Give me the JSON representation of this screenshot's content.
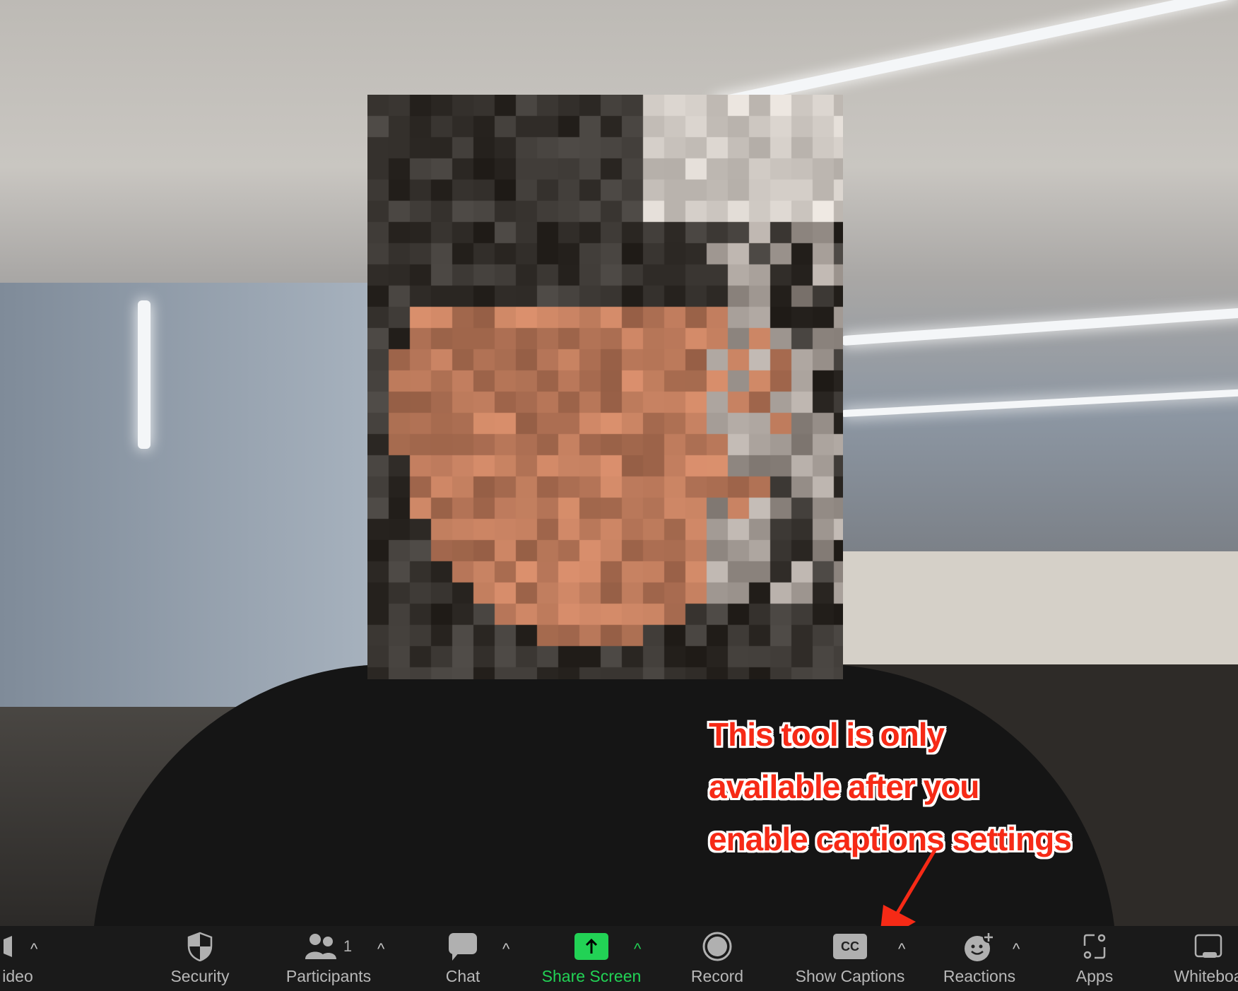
{
  "annotation": {
    "lines": [
      "This tool is only",
      "available after you",
      "enable captions settings"
    ],
    "color": "#f62a16"
  },
  "toolbar": {
    "items": [
      {
        "label": "ideo",
        "icon": "video-camera-icon"
      },
      {
        "label": "Security",
        "icon": "shield-icon"
      },
      {
        "label": "Participants",
        "icon": "participants-icon",
        "count": "1"
      },
      {
        "label": "Chat",
        "icon": "chat-bubble-icon"
      },
      {
        "label": "Share Screen",
        "icon": "share-screen-icon",
        "color": "#22d255"
      },
      {
        "label": "Record",
        "icon": "record-icon"
      },
      {
        "label": "Show Captions",
        "icon": "cc-icon",
        "icon_text": "CC"
      },
      {
        "label": "Reactions",
        "icon": "emoji-add-icon"
      },
      {
        "label": "Apps",
        "icon": "apps-icon"
      },
      {
        "label": "Whiteboa",
        "icon": "whiteboard-icon"
      }
    ],
    "caret": "^"
  }
}
